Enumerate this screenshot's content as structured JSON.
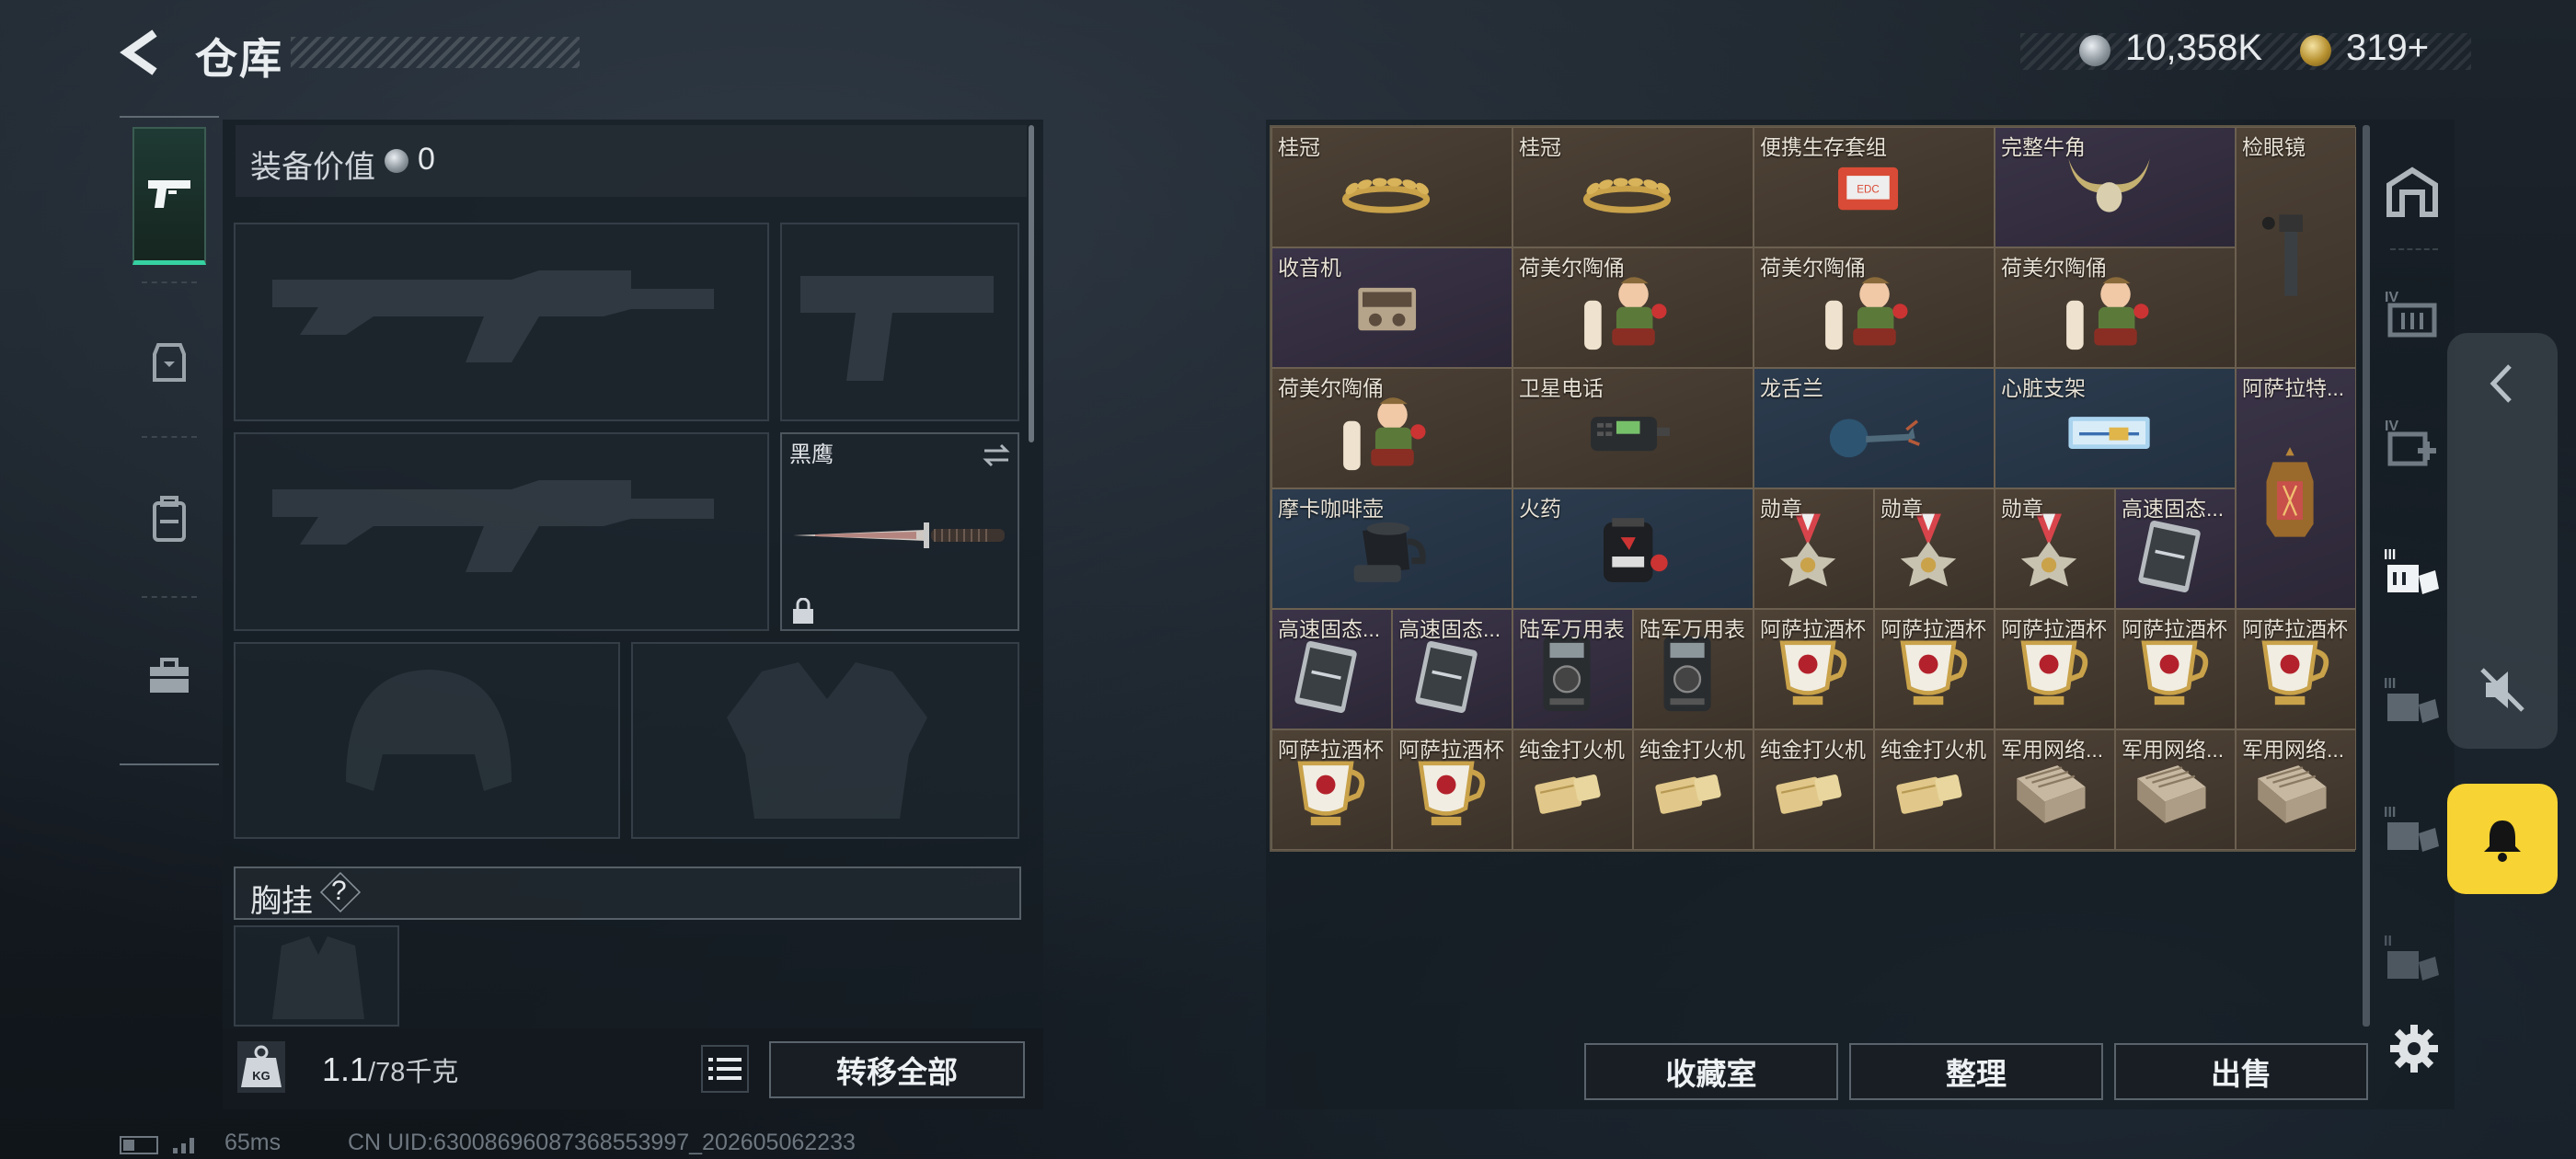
{
  "header": {
    "title": "仓库",
    "silver": "10,358K",
    "gold": "319+"
  },
  "left": {
    "equip_value_label": "装备价值",
    "equip_value": "0",
    "melee_name": "黑鹰",
    "chest_label": "胸挂",
    "chest_hint": "?",
    "weight_value": "1.1",
    "weight_unit": "/78千克",
    "transfer_all": "转移全部"
  },
  "status": {
    "ping": "65ms",
    "uid": "CN UID:63008696087368553997_202605062233"
  },
  "buttons": {
    "collection": "收藏室",
    "sort": "整理",
    "sell": "出售"
  },
  "grid": {
    "items": [
      {
        "label": "桂冠",
        "icon": "laurel-crown"
      },
      {
        "label": "桂冠",
        "icon": "laurel-crown"
      },
      {
        "label": "便携生存套组",
        "icon": "survival-kit"
      },
      {
        "label": "完整牛角",
        "icon": "bull-horns"
      },
      {
        "label": "检眼镜",
        "icon": "ophthalmoscope"
      },
      {
        "label": "收音机",
        "icon": "radio"
      },
      {
        "label": "荷美尔陶俑",
        "icon": "hummel-figurine"
      },
      {
        "label": "荷美尔陶俑",
        "icon": "hummel-figurine"
      },
      {
        "label": "荷美尔陶俑",
        "icon": "hummel-figurine"
      },
      {
        "label": "荷美尔陶俑",
        "icon": "hummel-figurine"
      },
      {
        "label": "卫星电话",
        "icon": "satellite-phone"
      },
      {
        "label": "龙舌兰",
        "icon": "agave"
      },
      {
        "label": "心脏支架",
        "icon": "heart-stent"
      },
      {
        "label": "阿萨拉特...",
        "icon": "lantern"
      },
      {
        "label": "摩卡咖啡壶",
        "icon": "moka-pot"
      },
      {
        "label": "火药",
        "icon": "gunpowder"
      },
      {
        "label": "勋章",
        "icon": "medal"
      },
      {
        "label": "勋章",
        "icon": "medal"
      },
      {
        "label": "勋章",
        "icon": "medal"
      },
      {
        "label": "高速固态...",
        "icon": "ssd"
      },
      {
        "label": "高速固态...",
        "icon": "ssd"
      },
      {
        "label": "高速固态...",
        "icon": "ssd"
      },
      {
        "label": "陆军万用表",
        "icon": "multimeter"
      },
      {
        "label": "陆军万用表",
        "icon": "multimeter"
      },
      {
        "label": "阿萨拉酒杯",
        "icon": "gold-cup"
      },
      {
        "label": "阿萨拉酒杯",
        "icon": "gold-cup"
      },
      {
        "label": "阿萨拉酒杯",
        "icon": "gold-cup"
      },
      {
        "label": "阿萨拉酒杯",
        "icon": "gold-cup"
      },
      {
        "label": "阿萨拉酒杯",
        "icon": "gold-cup"
      },
      {
        "label": "阿萨拉酒杯",
        "icon": "gold-cup"
      },
      {
        "label": "阿萨拉酒杯",
        "icon": "gold-cup"
      },
      {
        "label": "纯金打火机",
        "icon": "gold-lighter"
      },
      {
        "label": "纯金打火机",
        "icon": "gold-lighter"
      },
      {
        "label": "纯金打火机",
        "icon": "gold-lighter"
      },
      {
        "label": "纯金打火机",
        "icon": "gold-lighter"
      },
      {
        "label": "军用网络...",
        "icon": "network-module"
      },
      {
        "label": "军用网络...",
        "icon": "network-module"
      },
      {
        "label": "军用网络...",
        "icon": "network-module"
      }
    ]
  }
}
